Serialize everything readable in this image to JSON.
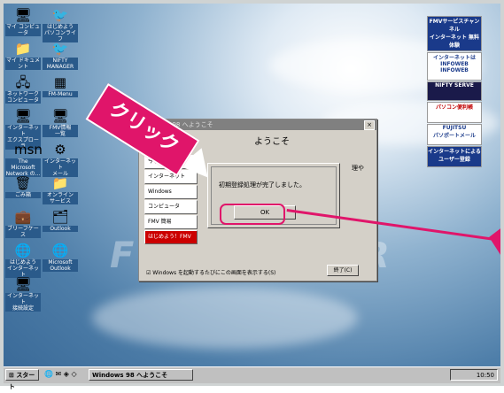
{
  "desktop_icons": [
    {
      "label": "マイ コンピュータ",
      "glyph": "🖥"
    },
    {
      "label": "はじめよう\nパソコンライフ",
      "glyph": "🐦"
    },
    {
      "label": "マイ ドキュメント",
      "glyph": "📁"
    },
    {
      "label": "NIFTY\nMANAGER",
      "glyph": "🐦"
    },
    {
      "label": "ネットワーク\nコンピュータ",
      "glyph": "🖧"
    },
    {
      "label": "FM-Menu",
      "glyph": "▦"
    },
    {
      "label": "インターネット\nエクスプローラ",
      "glyph": "🖥"
    },
    {
      "label": "FMV情報\n一覧",
      "glyph": "🖥"
    },
    {
      "label": "The Microsoft\nNetwork の...",
      "glyph": "msn"
    },
    {
      "label": "インターネット\nメール",
      "glyph": "⚙"
    },
    {
      "label": "ごみ箱",
      "glyph": "🗑"
    },
    {
      "label": "オンライン\nサービス",
      "glyph": "📁"
    },
    {
      "label": "ブリーフケース",
      "glyph": "💼"
    },
    {
      "label": "Outlook",
      "glyph": "🗂"
    },
    {
      "label": "はじめよう\nインターネット",
      "glyph": "🌐"
    },
    {
      "label": "Microsoft\nOutlook",
      "glyph": "🌐"
    },
    {
      "label": "インターネット\n接続設定",
      "glyph": "🖥"
    }
  ],
  "ads": [
    {
      "line1": "FMVサービスチャンネル",
      "line2": "インターネット 無料体験",
      "bg": "#1a3a8a",
      "color": "#ffffff"
    },
    {
      "line1": "インターネットはINFOWEB",
      "line2": "INFOWEB",
      "bg": "#ffffff",
      "color": "#1a3a8a"
    },
    {
      "line1": "NIFTY SERVE",
      "line2": "",
      "bg": "#1a1a4a",
      "color": "#ffffff"
    },
    {
      "line1": "パソコン便利帳",
      "line2": "",
      "bg": "#ffffff",
      "color": "#c00000"
    },
    {
      "line1": "FUJITSU",
      "line2": "パソポートメール",
      "bg": "#ffffff",
      "color": "#1a3a8a"
    },
    {
      "line1": "インターネットによる",
      "line2": "ユーザー登録",
      "bg": "#1a3a8a",
      "color": "#ffffff"
    }
  ],
  "welcome_window": {
    "title": "Windows 98 へようこそ",
    "close_glyph": "×",
    "heading": "ようこそ",
    "partial_text": "理や",
    "side_items": [
      "今すぐ",
      "インターネット",
      "Windows",
      "コンピュータ",
      "FMV 簡易",
      "はじめよう！FMV"
    ],
    "checkbox_label": "Windows を起動するたびにこの画面を表示する(S)",
    "close_button": "終了(C)"
  },
  "dialog": {
    "message": "初期登録処理が完了しました。",
    "ok_label": "OK"
  },
  "annotation": {
    "banner_text": "クリック"
  },
  "taskbar": {
    "start_label": "スタート",
    "task_label": "Windows 98 へようこそ",
    "clock": "10:50"
  }
}
